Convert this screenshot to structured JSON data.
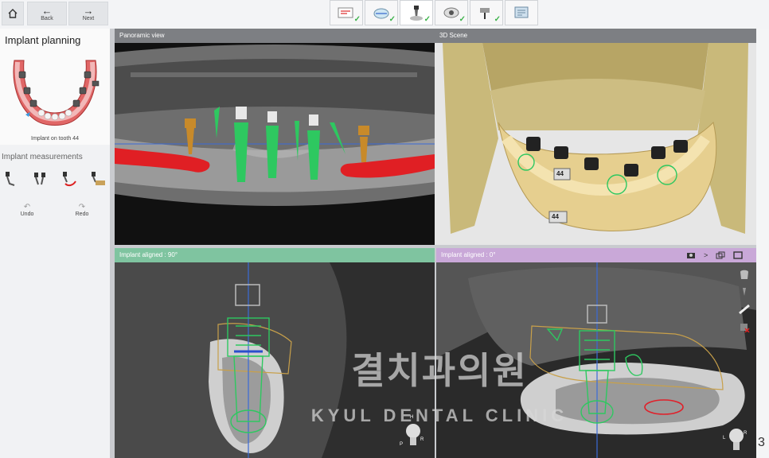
{
  "nav": {
    "home_icon": "home-icon",
    "back_label": "Back",
    "next_label": "Next",
    "back_arrow": "←",
    "next_arrow": "→"
  },
  "wizard_steps": [
    {
      "icon": "patient-data-icon",
      "done": true
    },
    {
      "icon": "scan-icon",
      "done": true
    },
    {
      "icon": "implant-icon",
      "done": true
    },
    {
      "icon": "sleeve-icon",
      "done": true
    },
    {
      "icon": "drill-icon",
      "done": true
    },
    {
      "icon": "export-icon",
      "done": false
    }
  ],
  "left_panel": {
    "title": "Implant planning",
    "thumbnail_caption": "Implant on tooth 44",
    "measurements_label": "Implant measurements",
    "undo_label": "Undo",
    "redo_label": "Redo"
  },
  "viewports": {
    "panoramic": {
      "title": "Panoramic view"
    },
    "scene3d": {
      "title": "3D Scene",
      "tooth_labels": [
        "44",
        "44"
      ]
    },
    "aligned90": {
      "title": "Implant aligned : 90°"
    },
    "aligned0": {
      "title": "Implant aligned : 0°",
      "toolbar_next": ">"
    }
  },
  "watermark": {
    "korean": "결치과의원",
    "english": "KYUL DENTAL CLINIC"
  },
  "orientation_letters": {
    "top": "H",
    "left": "P",
    "right": "R",
    "left2": "L",
    "right2": "R"
  },
  "right_edge_text": "3",
  "colors": {
    "implant_green": "#33cc55",
    "nerve_red": "#e0202a",
    "aligned90_header": "#7fc4a0",
    "aligned0_header": "#c9a8d8",
    "header_gray": "#7d7f83"
  }
}
